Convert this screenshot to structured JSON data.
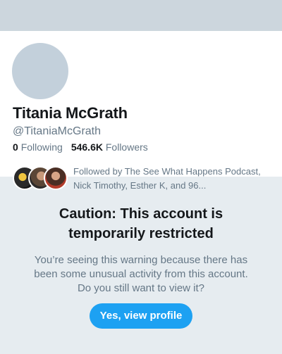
{
  "profile": {
    "display_name": "Titania McGrath",
    "handle": "@TitaniaMcGrath",
    "following_count": "0",
    "following_label": "Following",
    "followers_count": "546.6K",
    "followers_label": "Followers",
    "followed_by_text": "Followed by The See What Happens Podcast, Nick Timothy, Esther K, and 96..."
  },
  "warning": {
    "title_line1": "Caution: This account is",
    "title_line2": "temporarily restricted",
    "body": "You’re seeing this warning because there has been some unusual activity from this account. Do you still want to view it?",
    "button_label": "Yes, view profile"
  },
  "colors": {
    "accent": "#1da1f2",
    "background": "#e6ecf0",
    "text_primary": "#14171a",
    "text_secondary": "#657786"
  }
}
